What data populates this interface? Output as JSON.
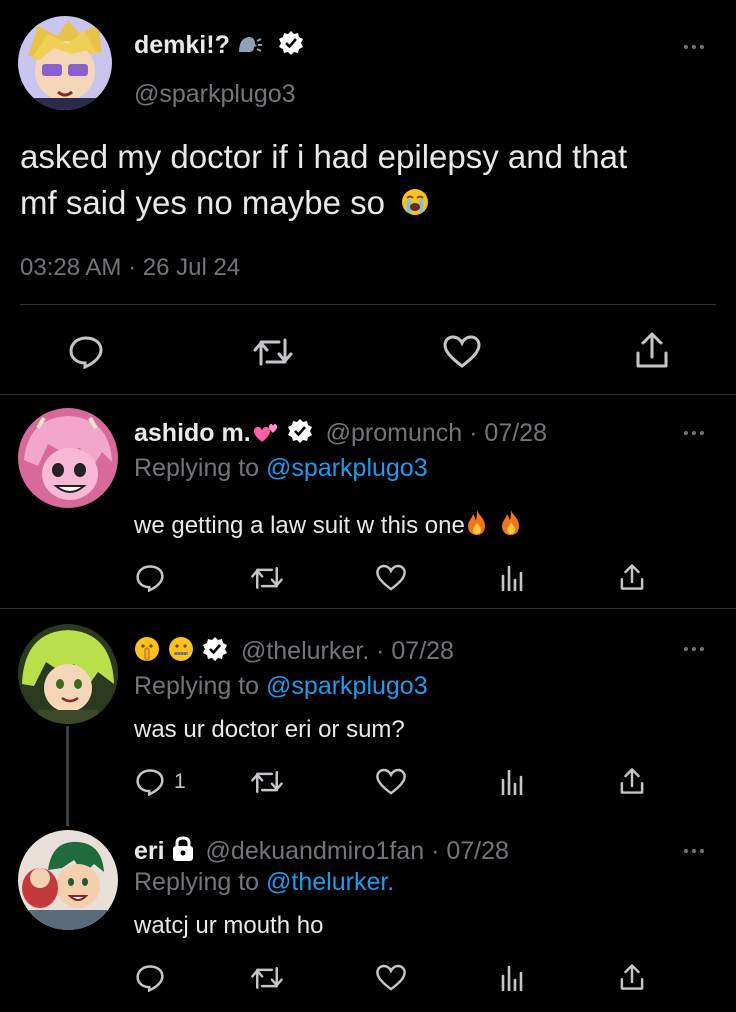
{
  "main_tweet": {
    "display_name": "demki!?",
    "name_emoji": "speaking-head-icon",
    "handle": "@sparkplugo3",
    "text_line1": "asked my doctor if i had epilepsy and that",
    "text_line2": "mf said yes no maybe so",
    "text_emoji": "loudly-crying-face-icon",
    "timestamp": "03:28 AM · 26 Jul 24"
  },
  "replies": [
    {
      "display_name": "ashido m.",
      "name_emoji": "two-hearts-icon",
      "handle": "@promunch",
      "date": "· 07/28",
      "replying_prefix": "Replying to",
      "replying_handle": "@sparkplugo3",
      "text": "we getting a law suit w this one",
      "text_emoji": "fire-icon",
      "reply_count": ""
    },
    {
      "display_name": "",
      "name_emoji": "shushing-face-icon zipper-mouth-face-icon",
      "handle": "@thelurker.",
      "date": "· 07/28",
      "replying_prefix": "Replying to",
      "replying_handle": "@sparkplugo3",
      "text": "was ur doctor eri or sum?",
      "reply_count": "1"
    },
    {
      "display_name": "eri",
      "name_emoji": "lock-icon",
      "handle": "@dekuandmiro1fan",
      "date": "· 07/28",
      "replying_prefix": "Replying to",
      "replying_handle": "@thelurker.",
      "text": "watcj ur mouth ho",
      "reply_count": ""
    }
  ],
  "colors": {
    "background": "#000000",
    "text": "#e7e9ea",
    "muted": "#71767b",
    "link": "#1d9bf0",
    "divider": "#2f3336",
    "verified_badge": "#ffffff"
  }
}
